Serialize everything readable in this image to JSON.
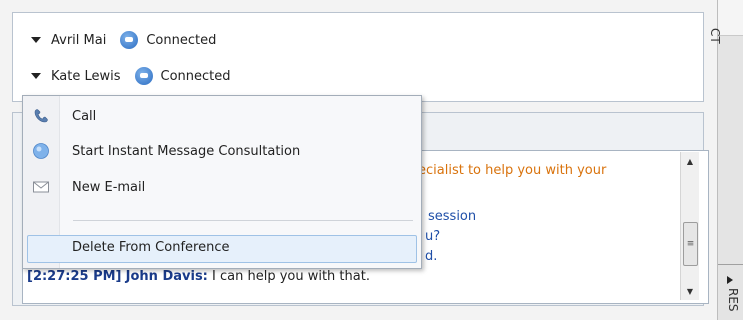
{
  "participants": [
    {
      "name": "Avril Mai",
      "status": "Connected"
    },
    {
      "name": "Kate Lewis",
      "status": "Connected"
    }
  ],
  "menu": {
    "items": [
      "Call",
      "Start Instant Message Consultation",
      "New E-mail"
    ],
    "delete_label": "Delete From Conference"
  },
  "chat": {
    "partial_1": "ecialist to help you with your",
    "partial_2": "session",
    "partial_3": "u?",
    "partial_4": "d.",
    "last_time": "[2:27:25 PM]",
    "last_author": "John Davis:",
    "last_text": "I can help you with that."
  },
  "rail": {
    "top_tab": "CT",
    "bottom_tab": "RES"
  },
  "colors": {
    "accent_blue": "#1f4fa8",
    "agent_orange": "#d9730d",
    "highlight": "#e6f0fb"
  }
}
